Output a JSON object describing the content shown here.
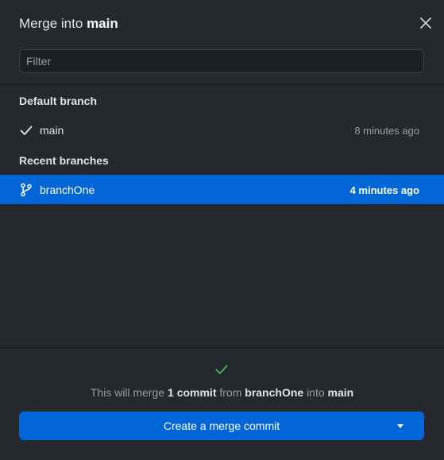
{
  "dialog": {
    "title_prefix": "Merge into",
    "title_branch": "main",
    "close_icon": "close-icon"
  },
  "filter": {
    "placeholder": "Filter",
    "value": ""
  },
  "sections": {
    "default_heading": "Default branch",
    "recent_heading": "Recent branches"
  },
  "branches": {
    "default": {
      "name": "main",
      "time": "8 minutes ago",
      "icon": "check-icon"
    },
    "recent": [
      {
        "name": "branchOne",
        "time": "4 minutes ago",
        "icon": "git-branch-icon",
        "selected": true
      }
    ]
  },
  "footer": {
    "status_icon": "check-icon",
    "status_color": "#3fb950",
    "summary_prefix": "This will merge",
    "commit_count": "1 commit",
    "summary_from": "from",
    "source_branch": "branchOne",
    "summary_into": "into",
    "target_branch": "main",
    "button_label": "Create a merge commit",
    "button_caret_icon": "caret-down-icon"
  },
  "colors": {
    "background": "#24292e",
    "accent": "#0366d6",
    "success": "#3fb950"
  }
}
